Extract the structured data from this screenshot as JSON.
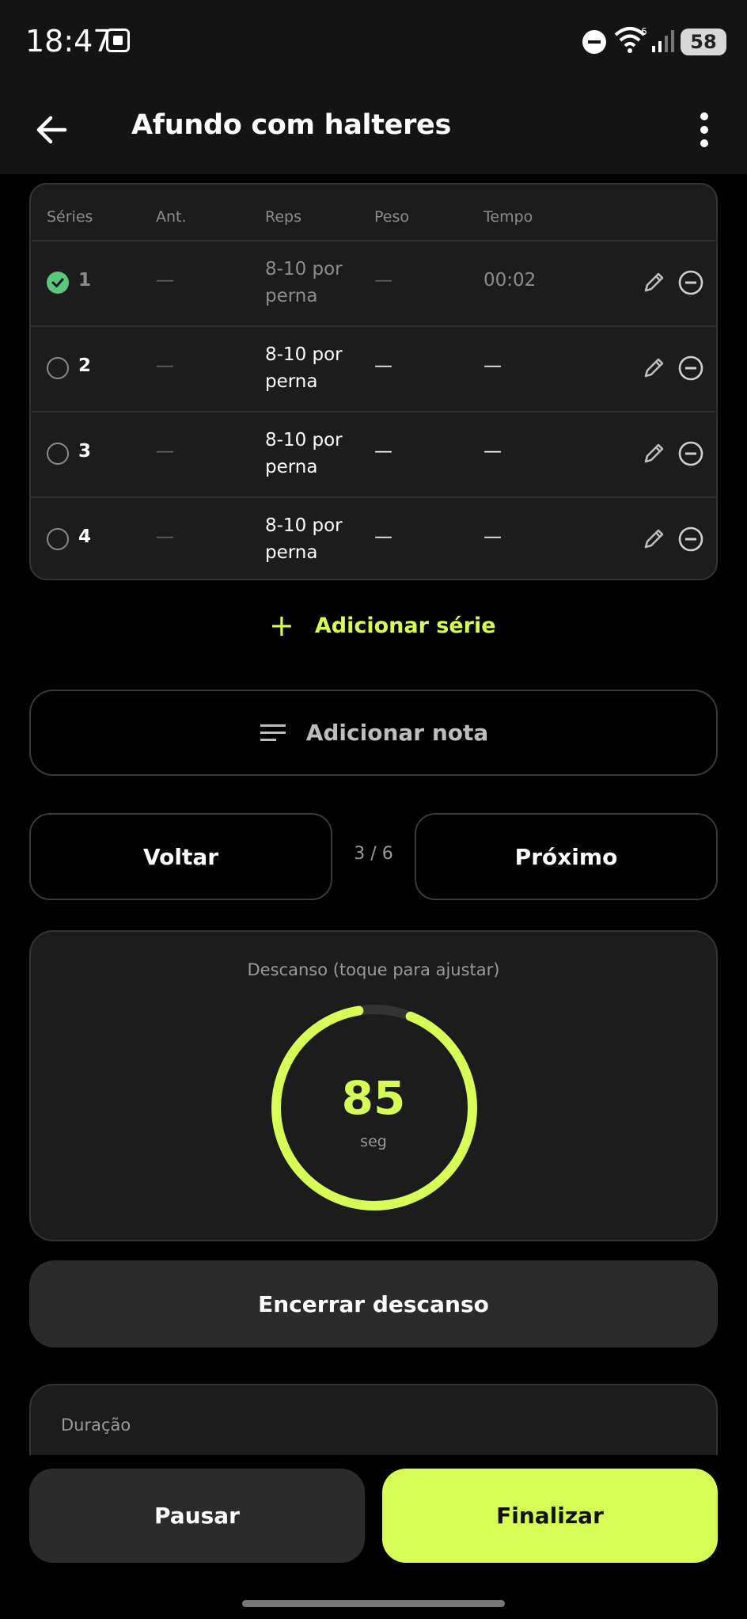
{
  "status_bar": {
    "time": "18:47",
    "battery": "58",
    "network_badge": "6",
    "icons": [
      "screenshot-icon",
      "dnd-icon",
      "wifi-icon",
      "signal-icon",
      "battery-icon"
    ]
  },
  "header": {
    "title": "Afundo com halteres",
    "back_icon": "arrow-left-icon",
    "menu_icon": "more-vertical-icon"
  },
  "sets_table": {
    "columns": [
      "Séries",
      "Ant.",
      "Reps",
      "Peso",
      "Tempo"
    ],
    "rows": [
      {
        "set": "1",
        "completed": true,
        "previous": "—",
        "reps": "8-10 por perna",
        "weight": "—",
        "time": "00:02"
      },
      {
        "set": "2",
        "completed": false,
        "previous": "—",
        "reps": "8-10 por perna",
        "weight": "—",
        "time": "—"
      },
      {
        "set": "3",
        "completed": false,
        "previous": "—",
        "reps": "8-10 por perna",
        "weight": "—",
        "time": "—"
      },
      {
        "set": "4",
        "completed": false,
        "previous": "—",
        "reps": "8-10 por perna",
        "weight": "—",
        "time": "—"
      }
    ],
    "row_icons": [
      "pencil-icon",
      "minus-circle-icon"
    ]
  },
  "actions": {
    "add_series": "Adicionar série",
    "add_note": "Adicionar nota"
  },
  "navigation": {
    "back_label": "Voltar",
    "next_label": "Próximo",
    "counter": "3 / 6"
  },
  "rest": {
    "label": "Descanso (toque para ajustar)",
    "value": "85",
    "unit": "seg",
    "progress": 0.94,
    "end_label": "Encerrar descanso"
  },
  "duration": {
    "label": "Duração"
  },
  "footer": {
    "pause_label": "Pausar",
    "finish_label": "Finalizar"
  },
  "colors": {
    "accent": "#d7fc55",
    "check": "#5ac77a",
    "card": "#1c1c1c",
    "button": "#2b2b2b"
  }
}
